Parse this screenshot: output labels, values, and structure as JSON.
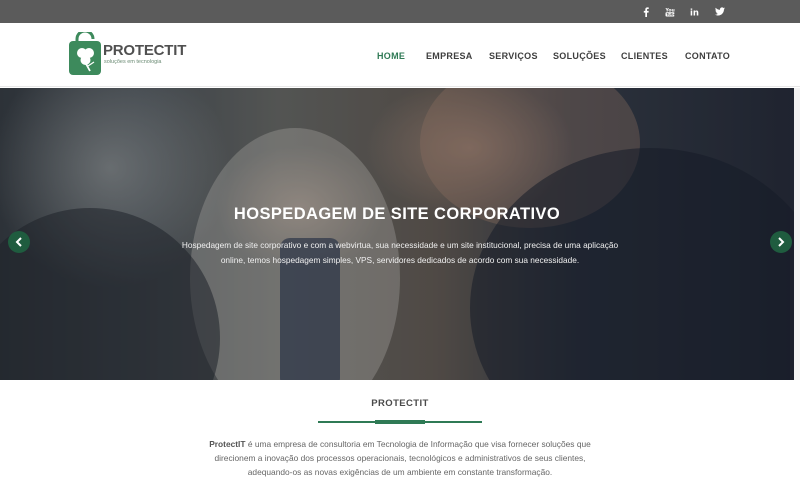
{
  "social": {
    "facebook_icon": "facebook-icon",
    "youtube_icon": "youtube-icon",
    "linkedin_icon": "linkedin-icon",
    "twitter_icon": "twitter-icon"
  },
  "brand": {
    "name": "PROTECTIT",
    "tagline": "soluções em tecnologia",
    "accent_color": "#2f7a55"
  },
  "nav": {
    "items": [
      {
        "label": "HOME",
        "active": true
      },
      {
        "label": "EMPRESA"
      },
      {
        "label": "SERVIÇOS"
      },
      {
        "label": "SOLUÇÕES"
      },
      {
        "label": "CLIENTES"
      },
      {
        "label": "CONTATO"
      }
    ]
  },
  "hero": {
    "title": "HOSPEDAGEM DE SITE CORPORATIVO",
    "text": "Hospedagem de site corporativo e com a webvirtua, sua necessidade e um site institucional, precisa de uma aplicação online, temos hospedagem simples, VPS, servidores dedicados de acordo com sua necessidade.",
    "prev_icon": "chevron-left-icon",
    "next_icon": "chevron-right-icon"
  },
  "about": {
    "title": "PROTECTIT",
    "company": "ProtectIT",
    "text": " é uma empresa de consultoria em Tecnologia de Informação que visa fornecer soluções que direcionem a inovação dos processos operacionais, tecnológicos e administrativos de seus clientes, adequando-os as novas exigências de um ambiente em constante transformação."
  }
}
